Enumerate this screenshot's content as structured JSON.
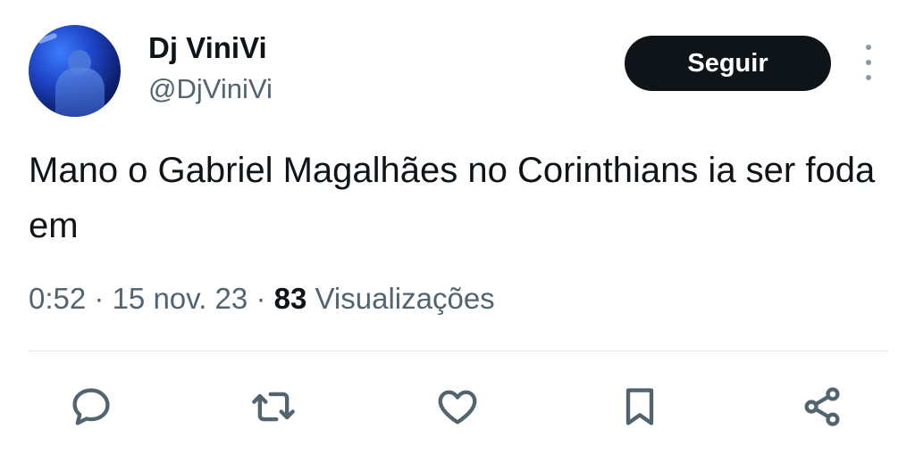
{
  "author": {
    "display_name": "Dj ViniVi",
    "handle": "@DjViniVi"
  },
  "follow_button": {
    "label": "Seguir"
  },
  "tweet": {
    "text": "Mano o Gabriel Magalhães no Corinthians ia ser foda em",
    "time": "0:52",
    "separator": "·",
    "date": "15 nov. 23",
    "views_count": "83",
    "views_label": "Visualizações"
  },
  "actions": [
    {
      "name": "reply",
      "icon": "speech-bubble-icon"
    },
    {
      "name": "retweet",
      "icon": "retweet-icon"
    },
    {
      "name": "like",
      "icon": "heart-icon"
    },
    {
      "name": "bookmark",
      "icon": "bookmark-icon"
    },
    {
      "name": "share",
      "icon": "share-icon"
    }
  ],
  "colors": {
    "text_primary": "#0f1419",
    "text_secondary": "#536471",
    "button_bg": "#0f1419",
    "button_text": "#ffffff",
    "divider": "#e4e7ea"
  }
}
